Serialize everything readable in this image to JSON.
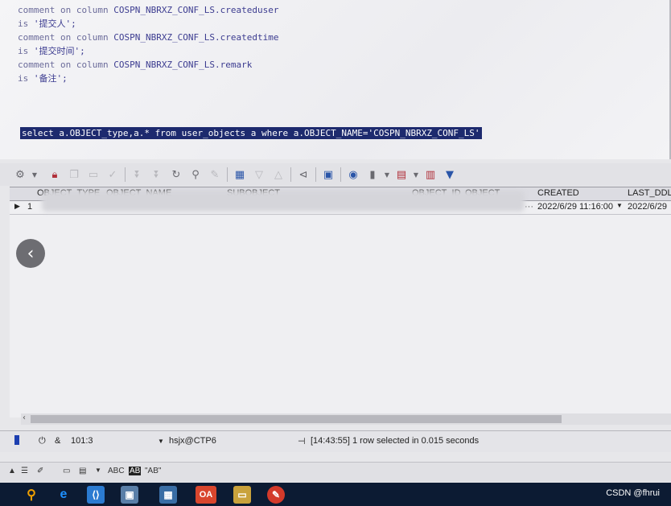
{
  "editor": {
    "lines": [
      {
        "kw": "comment on column",
        "rest": " COSPN_NBRXZ_CONF_LS.createduser"
      },
      {
        "kw": "is",
        "rest": " '提交人';"
      },
      {
        "kw": "comment on column",
        "rest": " COSPN_NBRXZ_CONF_LS.createdtime"
      },
      {
        "kw": "is",
        "rest": " '提交时间';"
      },
      {
        "kw": "comment on column",
        "rest": " COSPN_NBRXZ_CONF_LS.remark"
      },
      {
        "kw": "is",
        "rest": " '备注';"
      }
    ],
    "selected_query": "select a.OBJECT_type,a.* from user_objects a where a.OBJECT_NAME='COSPN_NBRXZ_CONF_LS'"
  },
  "grid": {
    "columns": [
      "OBJECT_TYPE",
      "OBJECT_NAME",
      "SUBOBJECT",
      "OBJECT_ID",
      "OBJECT_",
      "CREATED",
      "LAST_DDL"
    ],
    "row": {
      "num": "1",
      "created": "2022/6/29 11:16:00",
      "last_ddl": "2022/6/29",
      "more": "···"
    }
  },
  "status": {
    "position": "101:3",
    "connection": "hsjx@CTP6",
    "message": "[14:43:55]  1 row selected in 0.015 seconds"
  },
  "bottom_bar": {
    "abc": "ABC",
    "ab_box": "AB",
    "ab_quote": "\"AB\""
  },
  "taskbar": {
    "oa_label": "OA",
    "watermark": "CSDN @fhrui"
  },
  "colors": {
    "selection": "#1d2a6e",
    "code": "#3c3c90",
    "taskbar": "#0c1b33"
  }
}
